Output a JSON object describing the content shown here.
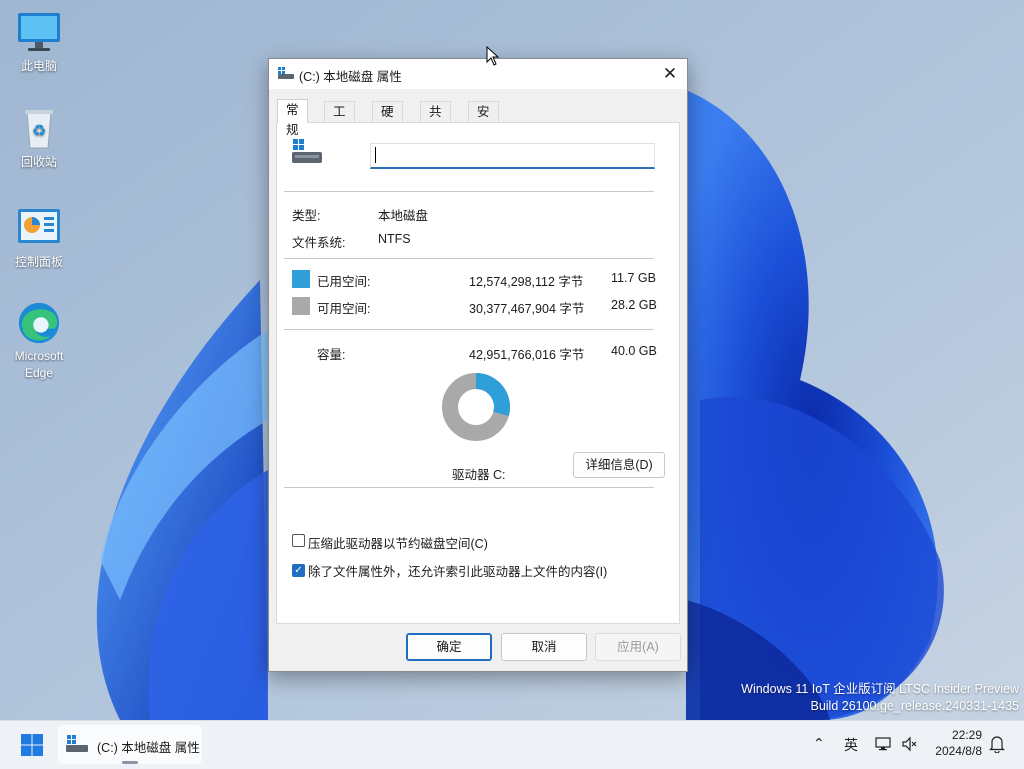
{
  "desktop": {
    "icons": [
      {
        "label": "此电脑",
        "icon": "computer-icon"
      },
      {
        "label": "回收站",
        "icon": "recycle-bin-icon"
      },
      {
        "label": "控制面板",
        "icon": "control-panel-icon"
      },
      {
        "label_line1": "Microsoft",
        "label_line2": "Edge",
        "icon": "edge-icon"
      }
    ],
    "watermark_line1": "Windows 11 IoT 企业版订阅 LTSC Insider Preview",
    "watermark_line2": "Build 26100.ge_release.240331-1435"
  },
  "dialog": {
    "title": "(C:) 本地磁盘 属性",
    "tabs": [
      "常规",
      "工具",
      "硬件",
      "共享",
      "安全"
    ],
    "active_tab": "常规",
    "name_value": "",
    "type_label": "类型:",
    "type_value": "本地磁盘",
    "fs_label": "文件系统:",
    "fs_value": "NTFS",
    "used": {
      "label": "已用空间:",
      "bytes": "12,574,298,112 字节",
      "size": "11.7 GB",
      "color": "#2f9fd9"
    },
    "free": {
      "label": "可用空间:",
      "bytes": "30,377,467,904 字节",
      "size": "28.2 GB",
      "color": "#a9a9a9"
    },
    "capacity": {
      "label": "容量:",
      "bytes": "42,951,766,016 字节",
      "size": "40.0 GB"
    },
    "used_fraction": 0.2928,
    "drive_label": "驱动器 C:",
    "details_button": "详细信息(D)",
    "compress_label": "压缩此驱动器以节约磁盘空间(C)",
    "compress_checked": false,
    "index_label": "除了文件属性外，还允许索引此驱动器上文件的内容(I)",
    "index_checked": true,
    "ok": "确定",
    "cancel": "取消",
    "apply": "应用(A)"
  },
  "taskbar": {
    "task_label": "(C:) 本地磁盘 属性",
    "ime": "英",
    "time": "22:29",
    "date": "2024/8/8"
  },
  "colors": {
    "accent": "#1f6ec1"
  }
}
